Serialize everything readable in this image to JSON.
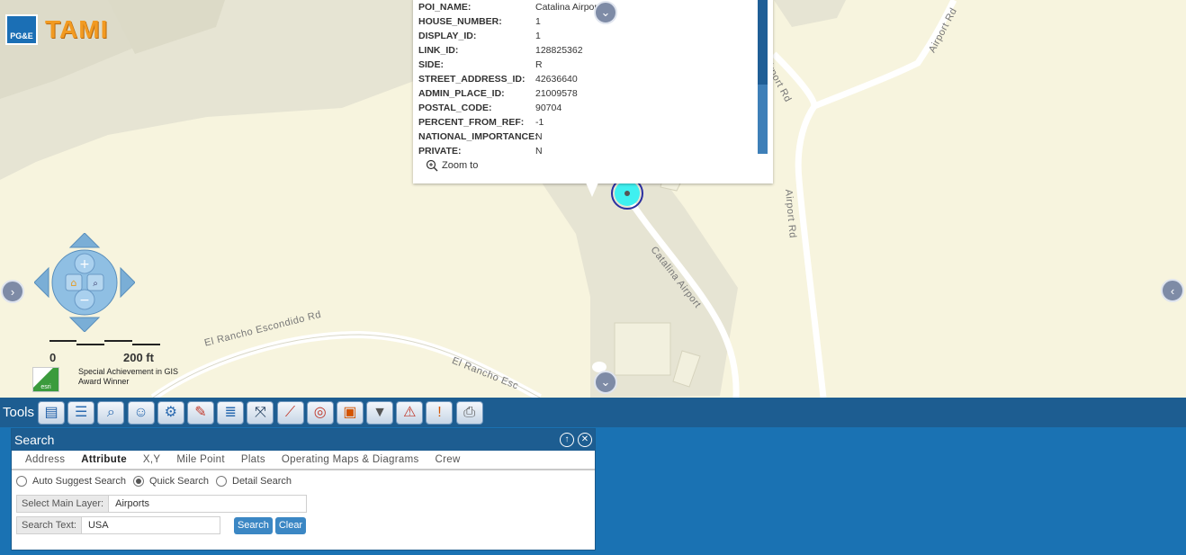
{
  "app": {
    "logo_text": "PG&E",
    "title": "TAMI"
  },
  "map": {
    "road_labels": [
      "El Rancho Escondido Rd",
      "El Rancho Esc",
      "Catalina Airport",
      "Airport Rd",
      "Airport Rd",
      "Airport Rd"
    ],
    "scale": {
      "start": "0",
      "end": "200 ft"
    },
    "award": {
      "logo": "esri",
      "line1": "Special  Achievement in GIS",
      "line2": "Award Winner"
    }
  },
  "popup": {
    "rows": [
      {
        "key": "POI_NAME:",
        "value": "Catalina Airport"
      },
      {
        "key": "HOUSE_NUMBER:",
        "value": "1"
      },
      {
        "key": "DISPLAY_ID:",
        "value": "1"
      },
      {
        "key": "LINK_ID:",
        "value": "128825362"
      },
      {
        "key": "SIDE:",
        "value": "R"
      },
      {
        "key": "STREET_ADDRESS_ID:",
        "value": "42636640"
      },
      {
        "key": "ADMIN_PLACE_ID:",
        "value": "21009578"
      },
      {
        "key": "POSTAL_CODE:",
        "value": "90704"
      },
      {
        "key": "PERCENT_FROM_REF:",
        "value": "-1"
      },
      {
        "key": "NATIONAL_IMPORTANCE:",
        "value": "N"
      },
      {
        "key": "PRIVATE:",
        "value": "N"
      }
    ],
    "zoom_to": "Zoom to"
  },
  "toolbar": {
    "label": "Tools",
    "tools": [
      {
        "icon": "layers-icon",
        "glyph": "▤",
        "color": "#1f5fa8"
      },
      {
        "icon": "legend-list-icon",
        "glyph": "☰",
        "color": "#2a6ab0"
      },
      {
        "icon": "identify-icon",
        "glyph": "⌕",
        "color": "#2a6ab0"
      },
      {
        "icon": "user-search-icon",
        "glyph": "☺",
        "color": "#2a6ab0"
      },
      {
        "icon": "settings-gears-icon",
        "glyph": "⚙",
        "color": "#2a6ab0"
      },
      {
        "icon": "map-tools-icon",
        "glyph": "✎",
        "color": "#c0392b"
      },
      {
        "icon": "layer-list-icon",
        "glyph": "≣",
        "color": "#2a6ab0"
      },
      {
        "icon": "measure-icon",
        "glyph": "⤧",
        "color": "#1d3b5c"
      },
      {
        "icon": "trace-icon",
        "glyph": "⟋",
        "color": "#c0392b"
      },
      {
        "icon": "buffer-icon",
        "glyph": "◎",
        "color": "#c0392b"
      },
      {
        "icon": "select-area-icon",
        "glyph": "▣",
        "color": "#d35400"
      },
      {
        "icon": "filter-icon",
        "glyph": "▼",
        "color": "#555555"
      },
      {
        "icon": "warning-edit-icon",
        "glyph": "⚠",
        "color": "#c0392b"
      },
      {
        "icon": "alert-icon",
        "glyph": "!",
        "color": "#d35400"
      },
      {
        "icon": "print-icon",
        "glyph": "⎙",
        "color": "#555555"
      }
    ]
  },
  "search": {
    "title": "Search",
    "tabs": [
      "Address",
      "Attribute",
      "X,Y",
      "Mile Point",
      "Plats",
      "Operating Maps & Diagrams",
      "Crew"
    ],
    "active_tab": "Attribute",
    "radios": [
      {
        "label": "Auto Suggest Search",
        "checked": false
      },
      {
        "label": "Quick Search",
        "checked": true
      },
      {
        "label": "Detail Search",
        "checked": false
      }
    ],
    "main_layer_label": "Select Main Layer:",
    "main_layer_value": "Airports",
    "search_text_label": "Search Text:",
    "search_text_value": "USA",
    "search_button": "Search",
    "clear_button": "Clear"
  }
}
